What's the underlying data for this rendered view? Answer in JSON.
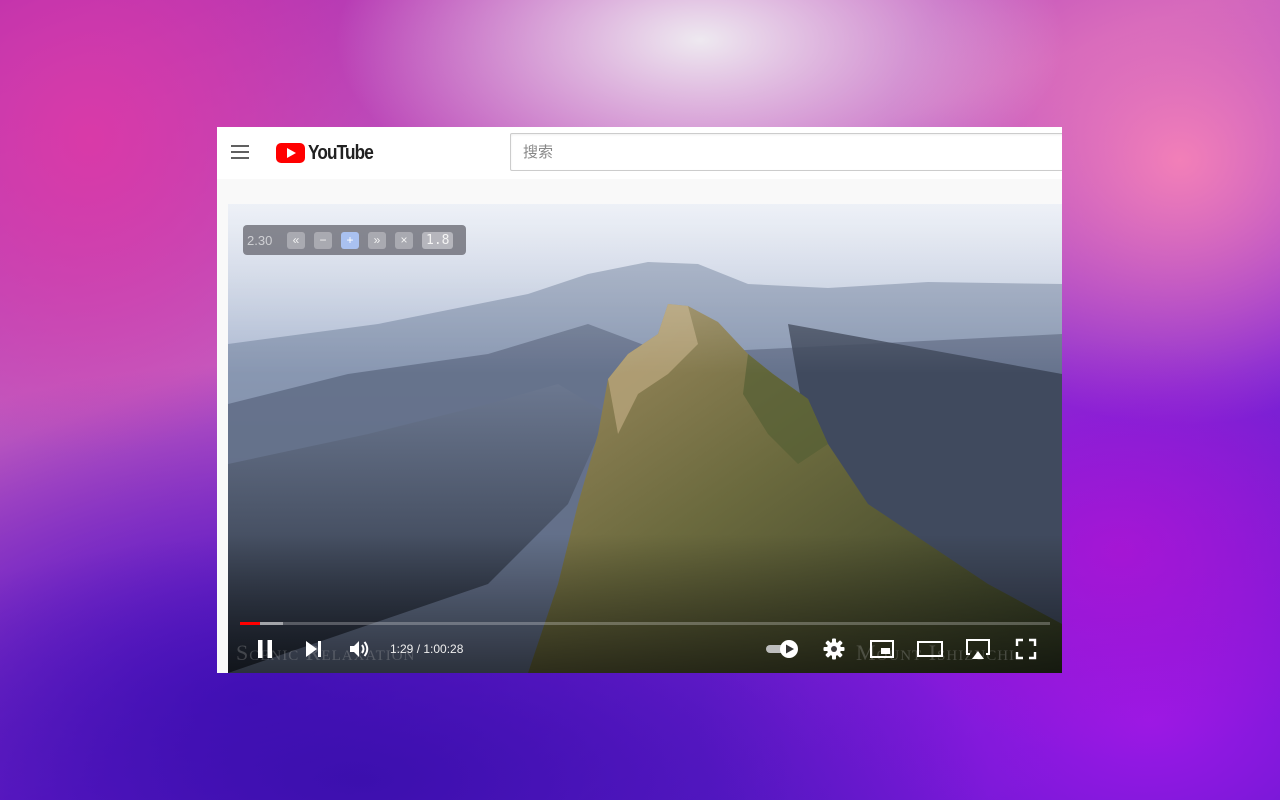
{
  "youtube": {
    "logo_text": "YouTube",
    "search_placeholder": "搜索"
  },
  "speed_controller": {
    "current_speed": "2.30",
    "buttons": [
      {
        "name": "rewind",
        "glyph": "«"
      },
      {
        "name": "slower",
        "glyph": "−"
      },
      {
        "name": "faster",
        "glyph": "+"
      },
      {
        "name": "advance",
        "glyph": "»"
      },
      {
        "name": "close",
        "glyph": "×"
      }
    ],
    "preset": "1.8"
  },
  "video": {
    "watermark_left": "Scenic Relaxation",
    "watermark_right": "Mount Ishizuchi"
  },
  "player": {
    "time_display": "1:29 / 1:00:28",
    "progress_played": 0.025,
    "progress_loaded": 0.053,
    "autoplay_on": true,
    "accent_color": "#ff0000"
  }
}
